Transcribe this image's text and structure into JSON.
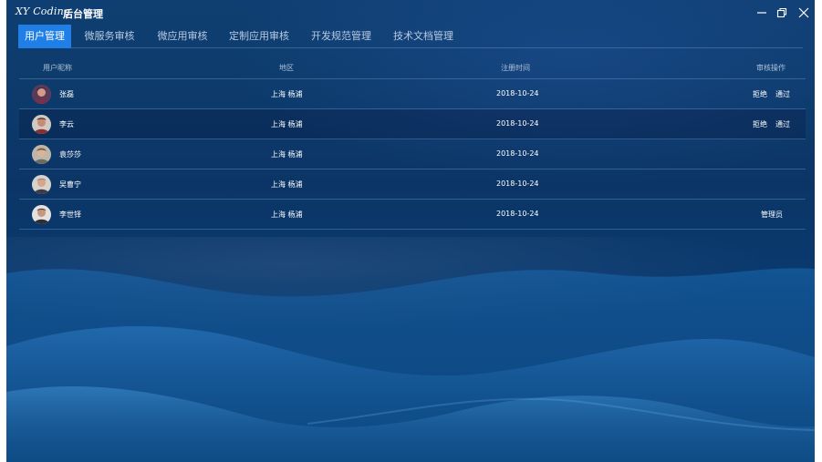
{
  "titlebar": {
    "logo_text": "XY Coding",
    "title": "后台管理",
    "icons": [
      "minimize-icon",
      "restore-icon",
      "close-icon"
    ]
  },
  "tabs": [
    {
      "label": "用户管理",
      "active": true
    },
    {
      "label": "微服务审核",
      "active": false
    },
    {
      "label": "微应用审核",
      "active": false
    },
    {
      "label": "定制应用审核",
      "active": false
    },
    {
      "label": "开发规范管理",
      "active": false
    },
    {
      "label": "技术文档管理",
      "active": false
    }
  ],
  "table": {
    "headers": {
      "nickname": "用户昵称",
      "region": "地区",
      "register_time": "注册时间",
      "actions": "审核操作"
    },
    "rows": [
      {
        "name": "张磊",
        "region": "上海 杨浦",
        "date": "2018-10-24",
        "reject": "拒绝",
        "approve": "通过",
        "role": ""
      },
      {
        "name": "李云",
        "region": "上海 杨浦",
        "date": "2018-10-24",
        "reject": "拒绝",
        "approve": "通过",
        "role": ""
      },
      {
        "name": "袁莎莎",
        "region": "上海 杨浦",
        "date": "2018-10-24",
        "reject": "",
        "approve": "",
        "role": ""
      },
      {
        "name": "吴曹宁",
        "region": "上海 杨浦",
        "date": "2018-10-24",
        "reject": "",
        "approve": "",
        "role": ""
      },
      {
        "name": "李世铎",
        "region": "上海 杨浦",
        "date": "2018-10-24",
        "reject": "",
        "approve": "",
        "role": "管理员"
      }
    ]
  },
  "colors": {
    "accent": "#1f7fe6",
    "background_top": "#0f3f72",
    "background_bottom": "#0d4d88",
    "text": "#ffffff"
  }
}
